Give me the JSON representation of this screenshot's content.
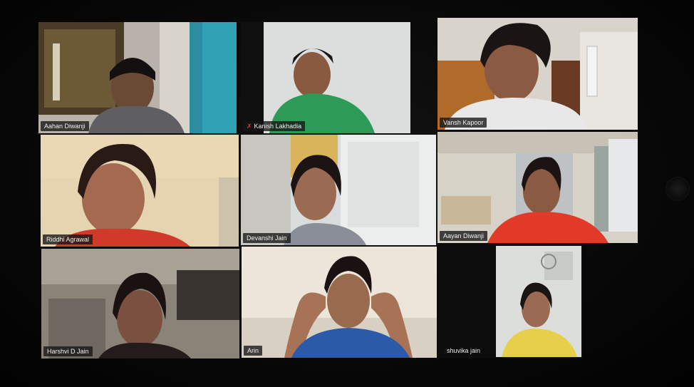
{
  "app": {
    "name": "Video conference gallery view"
  },
  "participants": [
    {
      "name": "Aahan Diwanji",
      "muted": false,
      "active": false
    },
    {
      "name": "Kanish Lakhadia",
      "muted": true,
      "active": false
    },
    {
      "name": "Vansh Kapoor",
      "muted": false,
      "active": false
    },
    {
      "name": "Riddhi Agrawal",
      "muted": false,
      "active": false
    },
    {
      "name": "Devanshi Jain",
      "muted": false,
      "active": false
    },
    {
      "name": "Aayan Diwanji",
      "muted": false,
      "active": true
    },
    {
      "name": "Harshvi D Jain",
      "muted": false,
      "active": false
    },
    {
      "name": "Arin",
      "muted": false,
      "active": false
    },
    {
      "name": "shuvika jain",
      "muted": false,
      "active": false
    }
  ],
  "icons": {
    "muted": "mic-muted-icon"
  },
  "colors": {
    "active_speaker_border": "#8fd15a",
    "muted_icon": "#e03a2f",
    "background": "#050505"
  }
}
